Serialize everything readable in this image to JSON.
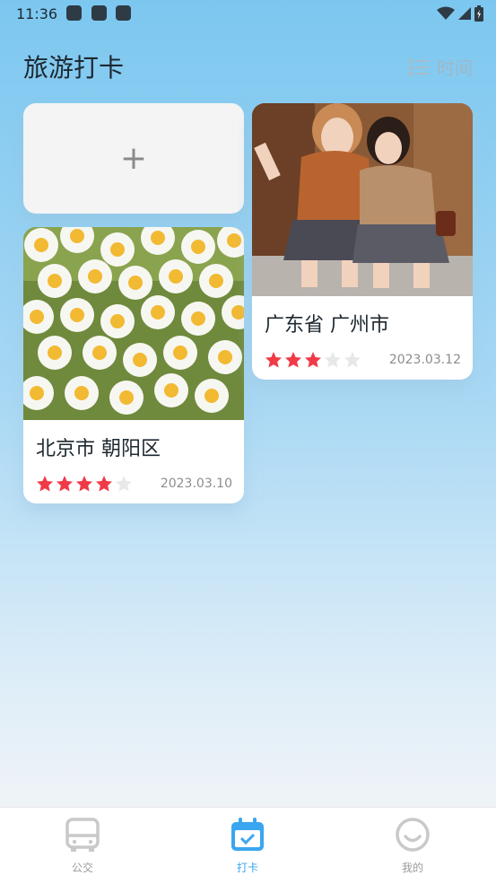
{
  "status": {
    "time": "11:36"
  },
  "header": {
    "title": "旅游打卡",
    "sort_label": "时间",
    "sort_icon": "list-icon"
  },
  "add_card": {
    "label": "+"
  },
  "cards": [
    {
      "place": "北京市 朝阳区",
      "rating": 4,
      "max_rating": 5,
      "date": "2023.03.10",
      "photo": "daisy-flowers-photo"
    },
    {
      "place": "广东省 广州市",
      "rating": 3,
      "max_rating": 5,
      "date": "2023.03.12",
      "photo": "two-friends-photo"
    }
  ],
  "nav": {
    "items": [
      {
        "label": "公交",
        "icon": "bus-icon",
        "active": false
      },
      {
        "label": "打卡",
        "icon": "calendar-check-icon",
        "active": true
      },
      {
        "label": "我的",
        "icon": "smiley-icon",
        "active": false
      }
    ]
  },
  "colors": {
    "accent": "#3aa6ef",
    "star_on": "#f03a47",
    "star_off": "#e8e8e8",
    "nav_inactive": "#c9c9c9"
  }
}
